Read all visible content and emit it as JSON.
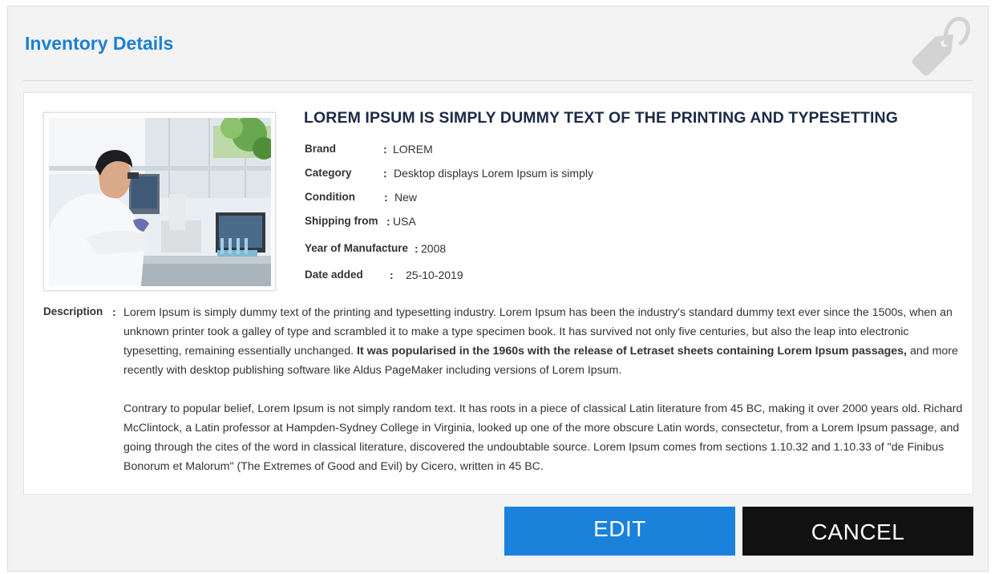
{
  "page": {
    "title": "Inventory Details"
  },
  "product": {
    "title": "LOREM IPSUM IS SIMPLY DUMMY TEXT OF THE PRINTING AND TYPESETTING",
    "specs": [
      {
        "label": "Brand",
        "value": "LOREM"
      },
      {
        "label": "Category",
        "value": "Desktop displays Lorem Ipsum is simply"
      },
      {
        "label": "Condition",
        "value": "New"
      },
      {
        "label": "Shipping from",
        "value": "USA"
      },
      {
        "label": "Year of Manufacture",
        "value": "2008"
      },
      {
        "label": "Date added",
        "value": "25-10-2019"
      }
    ]
  },
  "description": {
    "label": "Description",
    "p1_start": "Lorem Ipsum is simply dummy text of the printing and typesetting industry. Lorem Ipsum has been the industry's standard dummy text ever since the 1500s, when an unknown printer took a galley of type and scrambled it to make a type specimen book. It has survived not only five centuries, but also the leap into electronic typesetting, remaining essentially unchanged.",
    "p1_bold": "It was popularised in the 1960s with the release of Letraset sheets containing Lorem Ipsum passages,",
    "p1_end": "and more recently with desktop publishing software like Aldus PageMaker including versions of Lorem Ipsum.",
    "p2": "Contrary to popular belief, Lorem Ipsum is not simply random text. It has roots in a piece of classical Latin literature from 45 BC, making it over 2000 years old. Richard McClintock, a Latin professor at Hampden-Sydney College in Virginia, looked up one of the more obscure Latin words, consectetur, from a Lorem Ipsum passage, and going through the cites of the word in classical literature, discovered the undoubtable source. Lorem Ipsum comes from sections 1.10.32 and 1.10.33 of \"de Finibus Bonorum et Malorum\" (The Extremes of Good and Evil) by Cicero, written in 45 BC."
  },
  "actions": {
    "edit_label": "EDIT",
    "cancel_label": "CANCEL"
  },
  "icons": {
    "header": "price-tag-icon",
    "photo": "laboratory-scientist-photo"
  },
  "colors": {
    "accent": "#1a82db",
    "title": "#1b7fd4",
    "dark": "#111111",
    "panel": "#f3f3f3"
  }
}
